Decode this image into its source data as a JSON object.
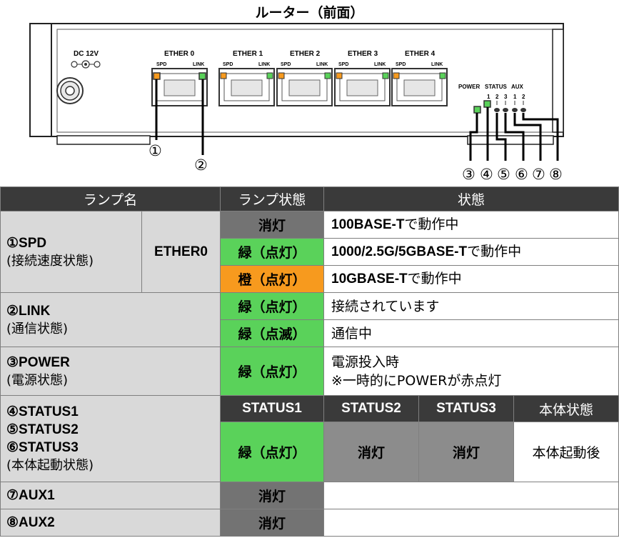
{
  "title": "ルーター（前面）",
  "device": {
    "dc": "DC 12V",
    "ports": [
      "ETHER 0",
      "ETHER 1",
      "ETHER 2",
      "ETHER 3",
      "ETHER 4"
    ],
    "spd": "SPD",
    "link": "LINK",
    "power": "POWER",
    "status": "STATUS",
    "aux": "AUX",
    "status_nums": [
      "1",
      "2",
      "3"
    ],
    "aux_nums": [
      "1",
      "2"
    ],
    "callouts": [
      "①",
      "②",
      "③",
      "④",
      "⑤",
      "⑥",
      "⑦",
      "⑧"
    ]
  },
  "colors": {
    "orange": "#f79a1e",
    "green": "#5ad25a",
    "dark": "#3a3a3a",
    "off": "#737373",
    "gray": "#d9d9d9"
  },
  "table": {
    "headers": [
      "ランプ名",
      "ランプ状態",
      "状態"
    ],
    "spd": {
      "name": "①SPD",
      "sub": "(接続速度状態)",
      "port": "ETHER0",
      "rows": [
        {
          "state": "消灯",
          "desc": "100BASE-T",
          "desc_suffix": "で動作中"
        },
        {
          "state": "緑（点灯）",
          "desc": "1000/2.5G/5GBASE-T",
          "desc_suffix": "で動作中"
        },
        {
          "state": "橙（点灯）",
          "desc": "10GBASE-T",
          "desc_suffix": "で動作中"
        }
      ]
    },
    "link": {
      "name": "②LINK",
      "sub": "(通信状態)",
      "rows": [
        {
          "state": "緑（点灯）",
          "desc": "接続されています"
        },
        {
          "state": "緑（点滅）",
          "desc": "通信中"
        }
      ]
    },
    "power": {
      "name": "③POWER",
      "sub": "(電源状態)",
      "state": "緑（点灯）",
      "desc1": "電源投入時",
      "desc2": "※一時的にPOWERが赤点灯"
    },
    "status": {
      "name1": "④STATUS1",
      "name2": "⑤STATUS2",
      "name3": "⑥STATUS3",
      "sub": "(本体起動状態)",
      "h1": "STATUS1",
      "h2": "STATUS2",
      "h3": "STATUS3",
      "h4": "本体状態",
      "v1": "緑（点灯）",
      "v2": "消灯",
      "v3": "消灯",
      "v4": "本体起動後"
    },
    "aux1": {
      "name": "⑦AUX1",
      "state": "消灯"
    },
    "aux2": {
      "name": "⑧AUX2",
      "state": "消灯"
    }
  }
}
